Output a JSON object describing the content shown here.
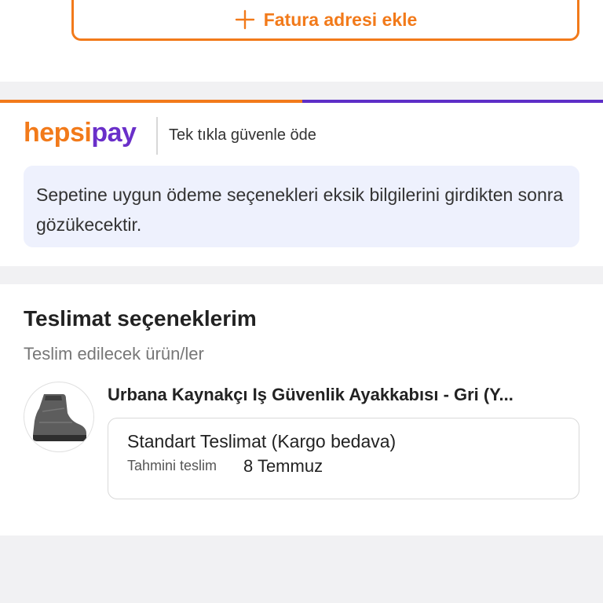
{
  "invoice": {
    "add_label": "Fatura adresi ekle",
    "icon": "plus-icon"
  },
  "hepsipay": {
    "logo_hepsi": "hepsi",
    "logo_pay": "pay",
    "tagline": "Tek tıkla güvenle öde",
    "info_text": "Sepetine uygun ödeme seçenekleri eksik bilgilerini girdikten sonra gözükecektir."
  },
  "delivery": {
    "title": "Teslimat seçeneklerim",
    "subtitle": "Teslim edilecek ürün/ler",
    "product_name": "Urbana Kaynakçı Iş Güvenlik Ayakkabısı - Gri (Y...",
    "option": {
      "title": "Standart Teslimat (Kargo bedava)",
      "eta_label": "Tahmini teslim",
      "eta_value": "8 Temmuz"
    }
  },
  "colors": {
    "accent_orange": "#f27a1a",
    "accent_purple": "#5d2ec7",
    "info_bg": "#eef1fd"
  }
}
